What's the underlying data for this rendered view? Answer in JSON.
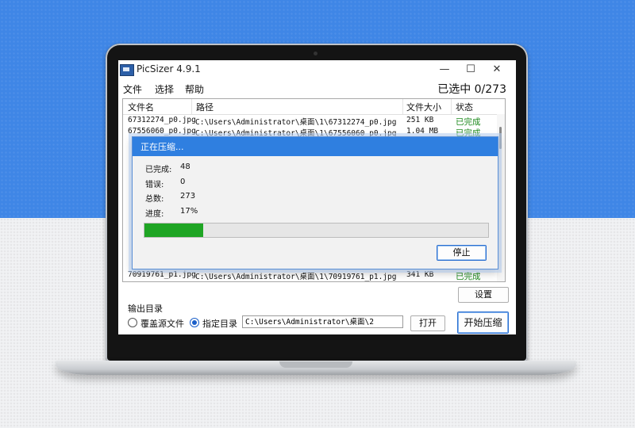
{
  "window": {
    "title": "PicSizer 4.9.1",
    "controls": {
      "minimize": "—",
      "maximize": "☐",
      "close": "✕"
    }
  },
  "menu": {
    "items": [
      "文件",
      "选择",
      "帮助"
    ]
  },
  "selection": {
    "text": "已选中 0/273"
  },
  "file_list": {
    "columns": [
      "文件名",
      "路径",
      "文件大小",
      "状态"
    ],
    "rows": [
      [
        "67312274_p0.jpg",
        "C:\\Users\\Administrator\\桌面\\1\\67312274_p0.jpg",
        "251 KB",
        "已完成"
      ],
      [
        "67556060_p0.jpg",
        "C:\\Users\\Administrator\\桌面\\1\\67556060_p0.jpg",
        "1.04 MB",
        "已完成"
      ],
      [
        "70919761_p1.jpg",
        "C:\\Users\\Administrator\\桌面\\1\\70919761_p1.jpg",
        "341 KB",
        "已完成"
      ]
    ]
  },
  "bottom": {
    "settings_label": "设置",
    "output_dir_label": "输出目录",
    "radio_overwrite": "覆盖源文件",
    "radio_specify": "指定目录",
    "selected_radio": "指定目录",
    "path_value": "C:\\Users\\Administrator\\桌面\\2",
    "open_label": "打开",
    "start_label": "开始压缩"
  },
  "dialog": {
    "title": "正在压缩...",
    "completed_label": "已完成:",
    "completed_value": "48",
    "errors_label": "错误:",
    "errors_value": "0",
    "total_label": "总数:",
    "total_value": "273",
    "progress_label": "进度:",
    "progress_value": "17%",
    "progress_fraction": 0.17,
    "stop_label": "停止"
  },
  "colors": {
    "background_blue": "#3f86e6",
    "dialog_titlebar": "#2f7fe0",
    "progress_green": "#1fa524",
    "status_done": "#1e8a1e"
  },
  "icons": {
    "app": "picsizer-app-icon"
  }
}
